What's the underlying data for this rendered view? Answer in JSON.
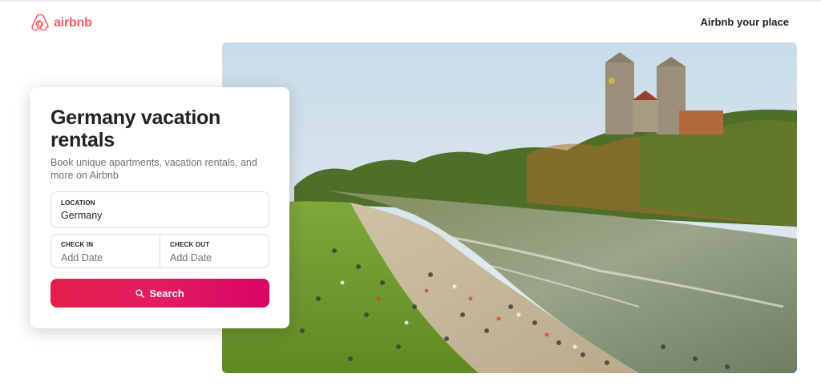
{
  "header": {
    "brand": "airbnb",
    "host_link": "Airbnb your place"
  },
  "hero": {
    "image": "riverbank-park-with-twin-tower-church"
  },
  "search_card": {
    "title": "Germany vacation rentals",
    "subtitle": "Book unique apartments, vacation rentals, and more on Airbnb",
    "location": {
      "label": "LOCATION",
      "value": "Germany"
    },
    "check_in": {
      "label": "CHECK IN",
      "placeholder": "Add Date"
    },
    "check_out": {
      "label": "CHECK OUT",
      "placeholder": "Add Date"
    },
    "button_label": "Search"
  },
  "colors": {
    "brand": "#FF5A5F",
    "button_gradient_start": "#E61E4D",
    "button_gradient_end": "#D70466"
  }
}
